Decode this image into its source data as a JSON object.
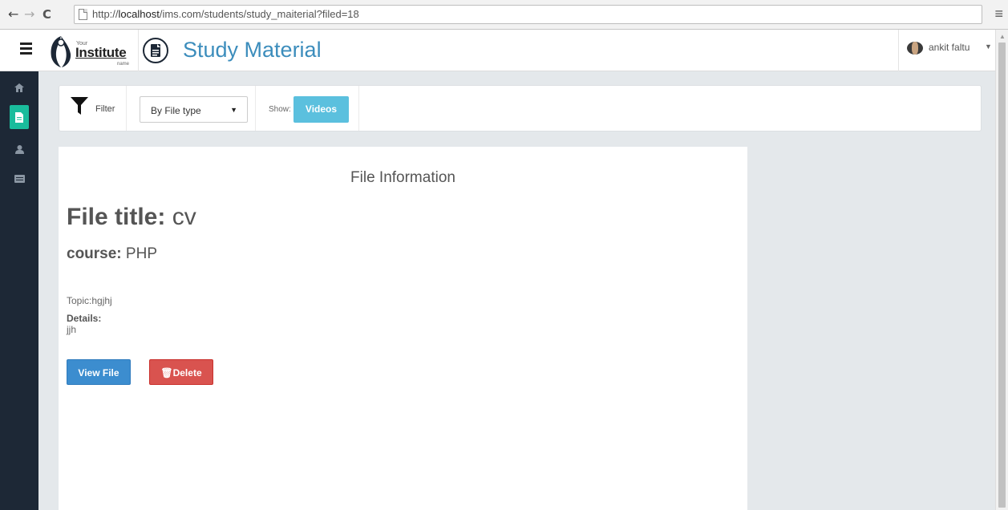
{
  "browser": {
    "url_prefix": "http://",
    "url_host": "localhost",
    "url_path": "/ims.com/students/study_maiterial?filed=18"
  },
  "header": {
    "logo_top": "Your",
    "logo_main": "Institute",
    "logo_bottom": "name",
    "page_title": "Study Material",
    "user_name": "ankit faltu"
  },
  "sidebar": {
    "items": [
      {
        "icon": "home-icon"
      },
      {
        "icon": "file-icon",
        "active": true
      },
      {
        "icon": "user-icon"
      },
      {
        "icon": "list-icon"
      }
    ]
  },
  "filter": {
    "label": "Filter",
    "select_value": "By File type",
    "show_label": "Show:",
    "show_button": "Videos"
  },
  "file_info": {
    "heading": "File Information",
    "title_label": "File title:",
    "title_value": "cv",
    "course_label": "course:",
    "course_value": "PHP",
    "topic": "Topic:hgjhj",
    "details_label": "Details:",
    "details_value": "jjh",
    "view_button": "View File",
    "delete_button": "Delete"
  },
  "colors": {
    "sidebar_bg": "#1d2836",
    "sidebar_active": "#1abc9c",
    "title_blue": "#3c8dbc",
    "info_button": "#5bc0de",
    "primary_button": "#3c8dcf",
    "danger_button": "#d9534f"
  }
}
